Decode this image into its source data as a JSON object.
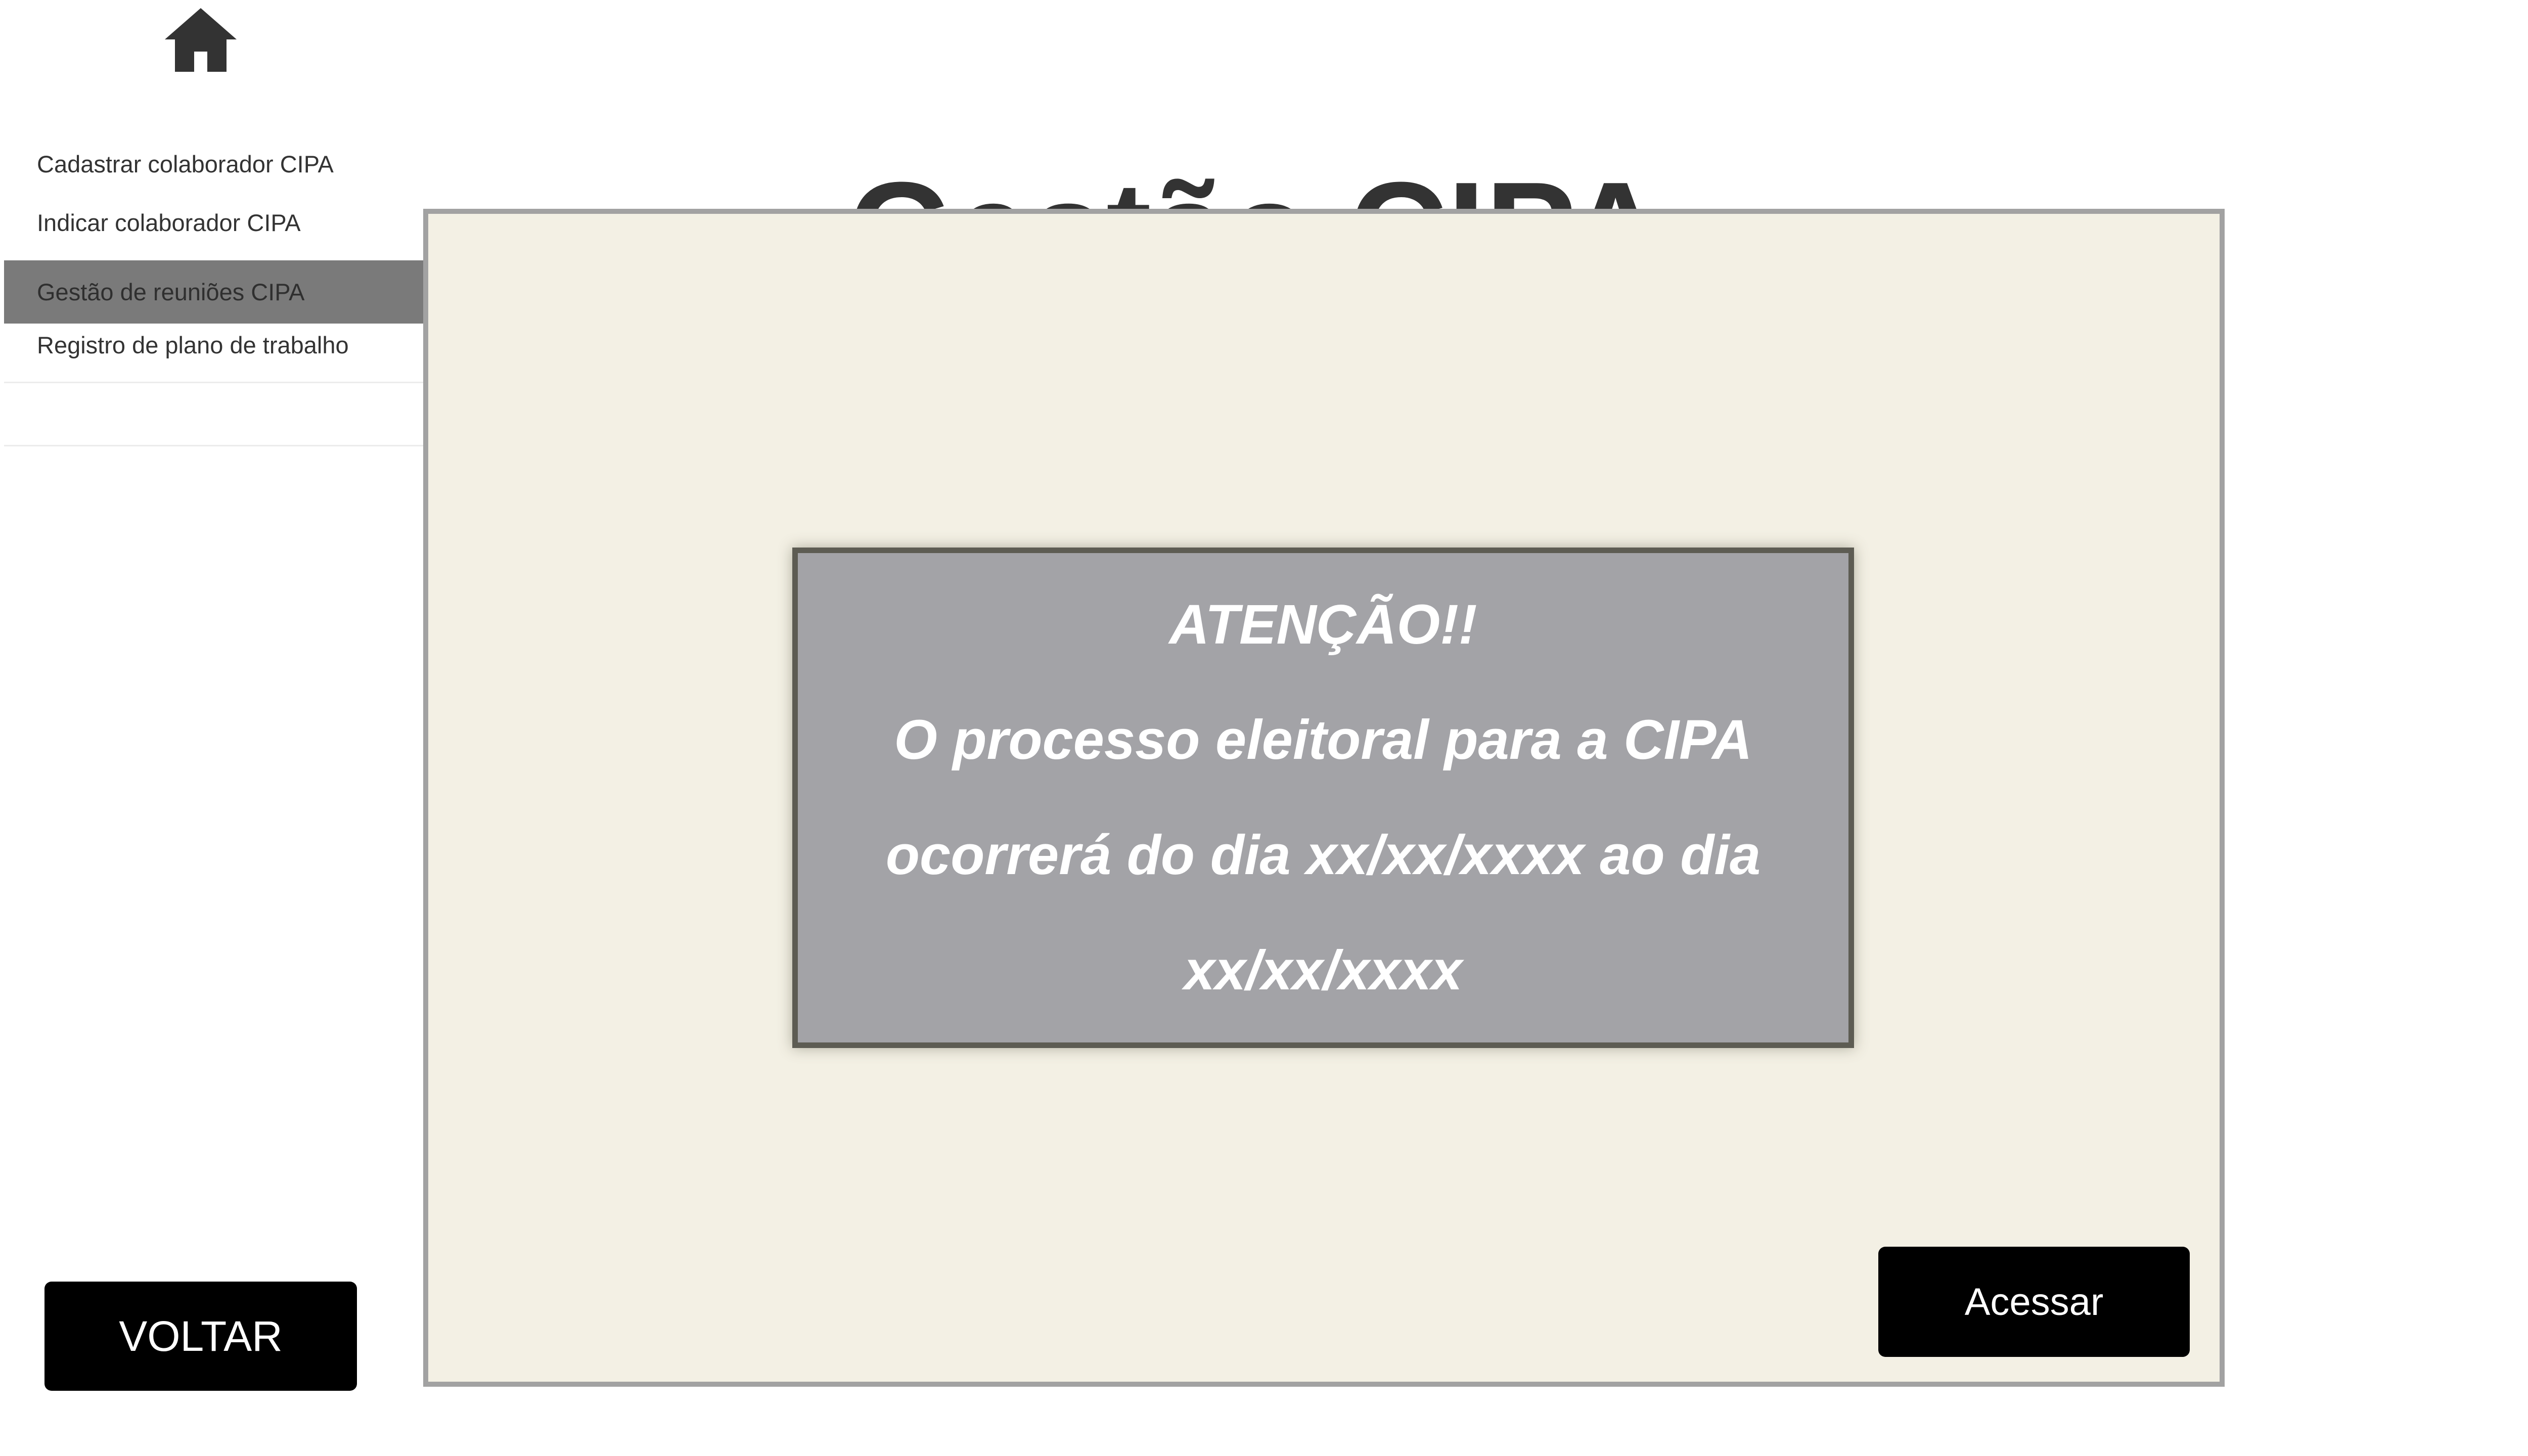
{
  "header": {
    "home_icon": "home-icon",
    "title": "Gestão CIPA"
  },
  "sidebar": {
    "items": [
      {
        "label": "Cadastrar colaborador CIPA",
        "active": false
      },
      {
        "label": "Indicar colaborador CIPA",
        "active": false
      },
      {
        "label": "Gestão de reuniões CIPA",
        "active": true
      },
      {
        "label": "Registro de plano de trabalho",
        "active": false
      }
    ]
  },
  "notice": {
    "heading": "ATENÇÃO!!",
    "lines": [
      "O processo eleitoral para a CIPA",
      "ocorrerá do dia xx/xx/xxxx ao dia",
      "xx/xx/xxxx"
    ]
  },
  "actions": {
    "access_label": "Acessar",
    "back_label": "VOLTAR"
  },
  "colors": {
    "panel_background": "#f3f0e4",
    "panel_border": "#a2a2a2",
    "notice_background": "#a3a3a7",
    "notice_border": "#5d5c53",
    "active_item_background": "#7a7a7a",
    "button_background": "#000000"
  }
}
